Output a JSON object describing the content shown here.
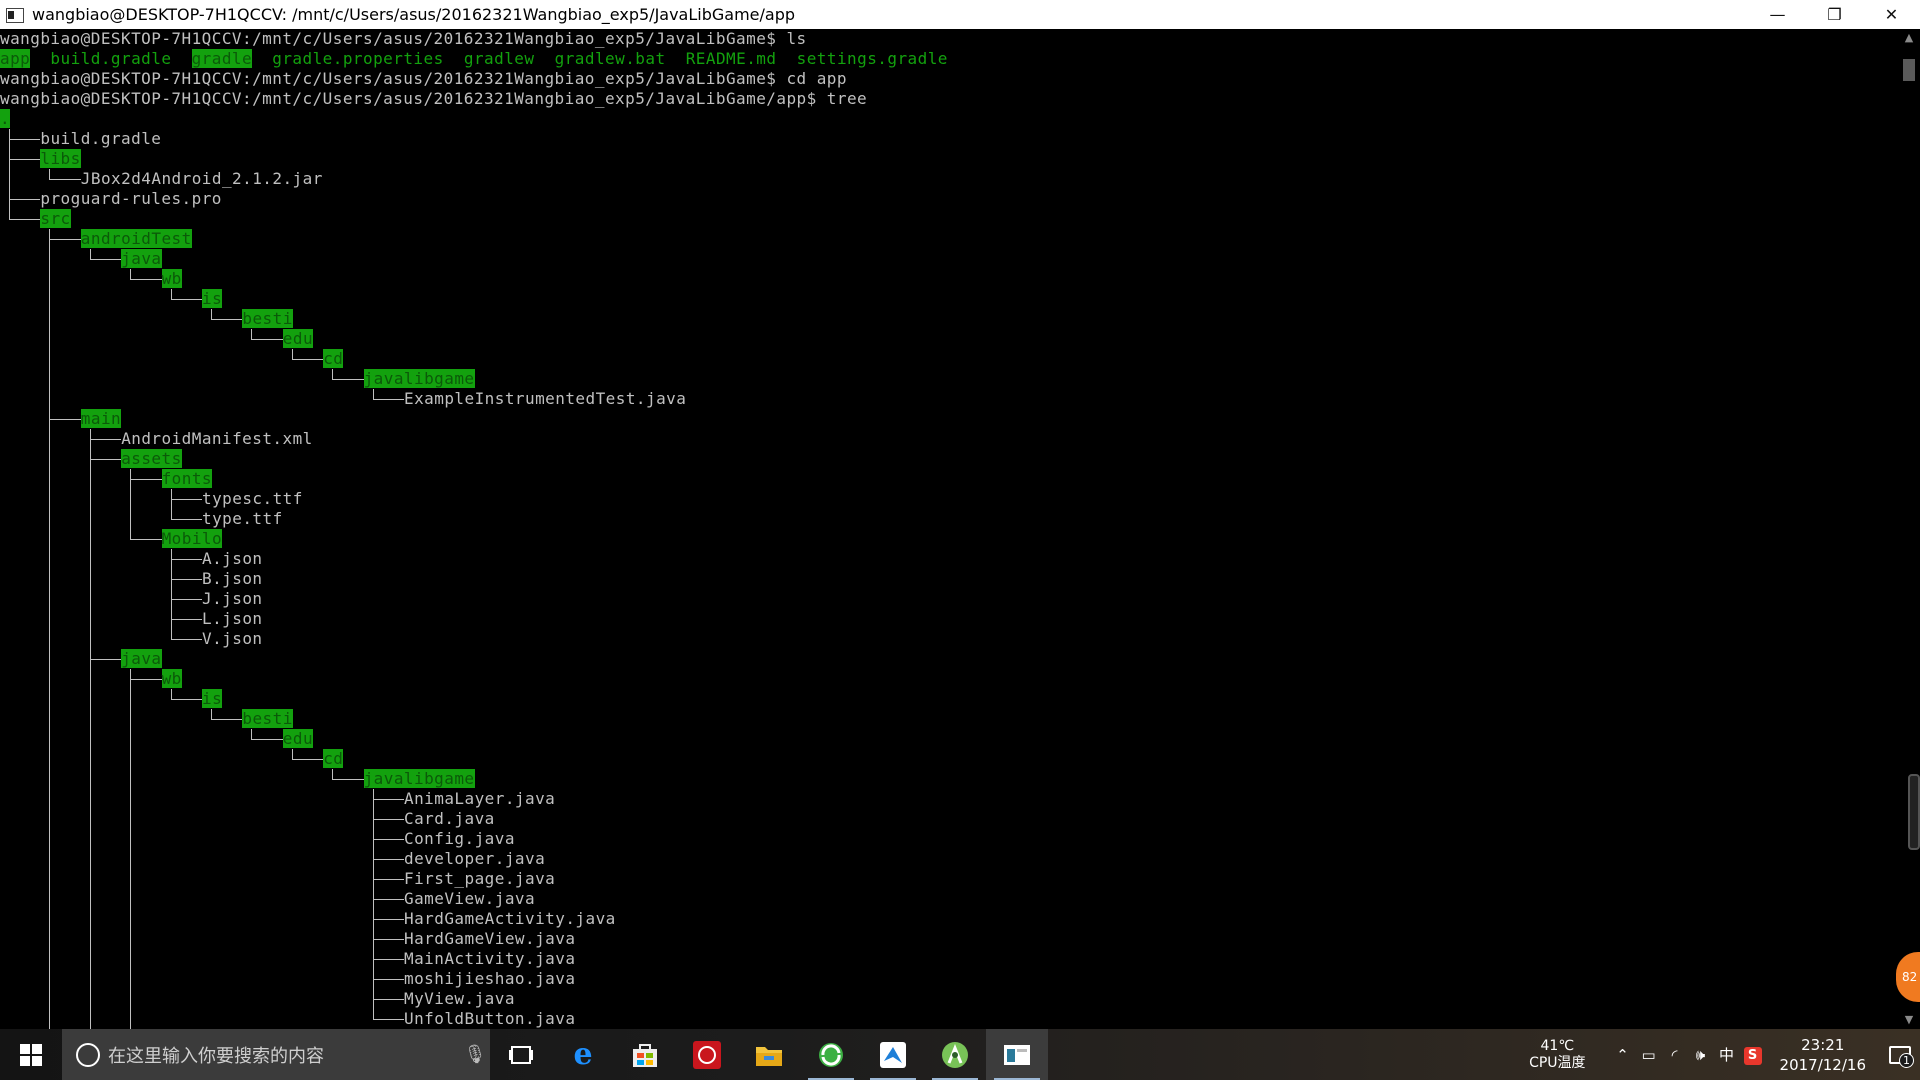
{
  "window": {
    "title": "wangbiao@DESKTOP-7H1QCCV: /mnt/c/Users/asus/20162321Wangbiao_exp5/JavaLibGame/app",
    "minimize_glyph": "—",
    "maximize_glyph": "❐",
    "close_glyph": "✕"
  },
  "terminal": {
    "prompt1": "wangbiao@DESKTOP-7H1QCCV:/mnt/c/Users/asus/20162321Wangbiao_exp5/JavaLibGame$ ls",
    "ls_output": [
      {
        "text": "app",
        "style": "dir"
      },
      {
        "text": "build.gradle",
        "style": "file"
      },
      {
        "text": "gradle",
        "style": "dir"
      },
      {
        "text": "gradle.properties",
        "style": "file"
      },
      {
        "text": "gradlew",
        "style": "file"
      },
      {
        "text": "gradlew.bat",
        "style": "file"
      },
      {
        "text": "README.md",
        "style": "file"
      },
      {
        "text": "settings.gradle",
        "style": "file"
      }
    ],
    "prompt2": "wangbiao@DESKTOP-7H1QCCV:/mnt/c/Users/asus/20162321Wangbiao_exp5/JavaLibGame$ cd app",
    "prompt3": "wangbiao@DESKTOP-7H1QCCV:/mnt/c/Users/asus/20162321Wangbiao_exp5/JavaLibGame/app$ tree",
    "tree": [
      {
        "name": ".",
        "depth": 0,
        "dir": true
      },
      {
        "name": "build.gradle",
        "depth": 1,
        "dir": false
      },
      {
        "name": "libs",
        "depth": 1,
        "dir": true
      },
      {
        "name": "JBox2d4Android_2.1.2.jar",
        "depth": 2,
        "dir": false
      },
      {
        "name": "proguard-rules.pro",
        "depth": 1,
        "dir": false
      },
      {
        "name": "src",
        "depth": 1,
        "dir": true
      },
      {
        "name": "androidTest",
        "depth": 2,
        "dir": true
      },
      {
        "name": "java",
        "depth": 3,
        "dir": true
      },
      {
        "name": "wb",
        "depth": 4,
        "dir": true
      },
      {
        "name": "is",
        "depth": 5,
        "dir": true
      },
      {
        "name": "besti",
        "depth": 6,
        "dir": true
      },
      {
        "name": "edu",
        "depth": 7,
        "dir": true
      },
      {
        "name": "cd",
        "depth": 8,
        "dir": true
      },
      {
        "name": "javalibgame",
        "depth": 9,
        "dir": true
      },
      {
        "name": "ExampleInstrumentedTest.java",
        "depth": 10,
        "dir": false
      },
      {
        "name": "main",
        "depth": 2,
        "dir": true
      },
      {
        "name": "AndroidManifest.xml",
        "depth": 3,
        "dir": false
      },
      {
        "name": "assets",
        "depth": 3,
        "dir": true
      },
      {
        "name": "fonts",
        "depth": 4,
        "dir": true
      },
      {
        "name": "typesc.ttf",
        "depth": 5,
        "dir": false
      },
      {
        "name": "type.ttf",
        "depth": 5,
        "dir": false
      },
      {
        "name": "Mobilo",
        "depth": 4,
        "dir": true
      },
      {
        "name": "A.json",
        "depth": 5,
        "dir": false
      },
      {
        "name": "B.json",
        "depth": 5,
        "dir": false
      },
      {
        "name": "J.json",
        "depth": 5,
        "dir": false
      },
      {
        "name": "L.json",
        "depth": 5,
        "dir": false
      },
      {
        "name": "V.json",
        "depth": 5,
        "dir": false
      },
      {
        "name": "java",
        "depth": 3,
        "dir": true
      },
      {
        "name": "wb",
        "depth": 4,
        "dir": true
      },
      {
        "name": "is",
        "depth": 5,
        "dir": true
      },
      {
        "name": "besti",
        "depth": 6,
        "dir": true
      },
      {
        "name": "edu",
        "depth": 7,
        "dir": true
      },
      {
        "name": "cd",
        "depth": 8,
        "dir": true
      },
      {
        "name": "javalibgame",
        "depth": 9,
        "dir": true
      },
      {
        "name": "AnimaLayer.java",
        "depth": 10,
        "dir": false
      },
      {
        "name": "Card.java",
        "depth": 10,
        "dir": false
      },
      {
        "name": "Config.java",
        "depth": 10,
        "dir": false
      },
      {
        "name": "developer.java",
        "depth": 10,
        "dir": false
      },
      {
        "name": "First_page.java",
        "depth": 10,
        "dir": false
      },
      {
        "name": "GameView.java",
        "depth": 10,
        "dir": false
      },
      {
        "name": "HardGameActivity.java",
        "depth": 10,
        "dir": false
      },
      {
        "name": "HardGameView.java",
        "depth": 10,
        "dir": false
      },
      {
        "name": "MainActivity.java",
        "depth": 10,
        "dir": false
      },
      {
        "name": "moshijieshao.java",
        "depth": 10,
        "dir": false
      },
      {
        "name": "MyView.java",
        "depth": 10,
        "dir": false
      },
      {
        "name": "UnfoldButton.java",
        "depth": 10,
        "dir": false
      }
    ],
    "colors": {
      "dir_bg": "#13a10e",
      "dir_fg": "#0b5a09",
      "file_green": "#13a10e",
      "text": "#c0c0c0"
    }
  },
  "side_badge": "82",
  "taskbar": {
    "search_placeholder": "在这里输入你要搜索的内容",
    "cpu_temp": "41℃",
    "cpu_label": "CPU温度",
    "ime_label": "中",
    "time": "23:21",
    "date": "2017/12/16",
    "notification_count": "1"
  }
}
